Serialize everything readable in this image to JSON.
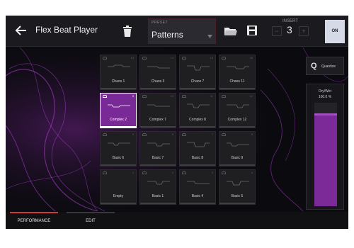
{
  "header": {
    "title": "Flex Beat Player",
    "preset_label": "PRESET",
    "preset_value": "Patterns",
    "insert_label": "INSERT",
    "insert_value": "3",
    "insert_minus": "−",
    "insert_plus": "+",
    "on_label": "ON"
  },
  "icons": {
    "back": "back-arrow-icon",
    "delete": "trash-icon",
    "open": "folder-icon",
    "save": "save-icon",
    "dropdown": "chevron-down-icon"
  },
  "pads": [
    {
      "name": "Chaos 1",
      "num": "13"
    },
    {
      "name": "Chaos 3",
      "num": "14"
    },
    {
      "name": "Chaos 7",
      "num": "15"
    },
    {
      "name": "Chaos 11",
      "num": "16"
    },
    {
      "name": "Complex 2",
      "num": "9",
      "selected": true
    },
    {
      "name": "Complex 7",
      "num": "10"
    },
    {
      "name": "Complex 8",
      "num": "11"
    },
    {
      "name": "Complex 12",
      "num": "12"
    },
    {
      "name": "Basic 6",
      "num": "5"
    },
    {
      "name": "Basic 7",
      "num": "6"
    },
    {
      "name": "Basic 8",
      "num": "7"
    },
    {
      "name": "Basic 9",
      "num": "8"
    },
    {
      "name": "Empty",
      "num": "1"
    },
    {
      "name": "Basic 1",
      "num": "2"
    },
    {
      "name": "Basic 4",
      "num": "3"
    },
    {
      "name": "Basic 5",
      "num": "4"
    }
  ],
  "quantize": {
    "icon_letter": "Q",
    "label": "Quantize"
  },
  "drywet": {
    "label": "Dry/Wet",
    "value_text": "100.0 %",
    "level_fraction": 0.9
  },
  "tabs": [
    {
      "label": "PERFORMANCE",
      "active": true
    },
    {
      "label": "EDIT",
      "active": false
    }
  ],
  "colors": {
    "accent": "#7a2a96",
    "tab_active": "#d23a3a",
    "on_button": "#d6d9e6"
  }
}
